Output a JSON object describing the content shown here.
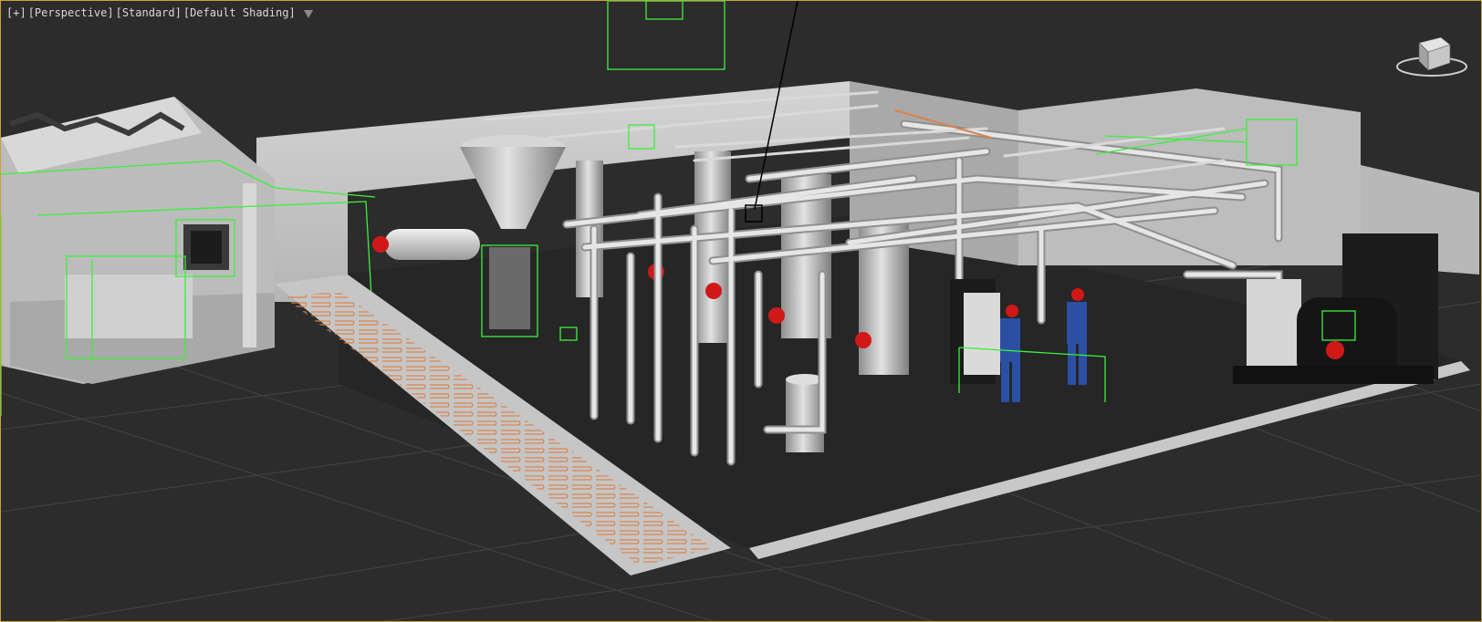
{
  "viewport": {
    "labels": [
      "[+]",
      "[Perspective]",
      "[Standard]",
      "[Default Shading]"
    ],
    "filter_icon": "filter-icon",
    "viewcube_icon": "viewcube-icon",
    "active_border_color": "#c8a040",
    "background_color": "#2c2c2c"
  },
  "scene": {
    "selection_color": "#3bf03b",
    "model_color": "#c9c9c9",
    "accent_red": "#d01818",
    "worker_uniform_color": "#2a4fa3",
    "heating_coil_color": "#d9824a"
  }
}
